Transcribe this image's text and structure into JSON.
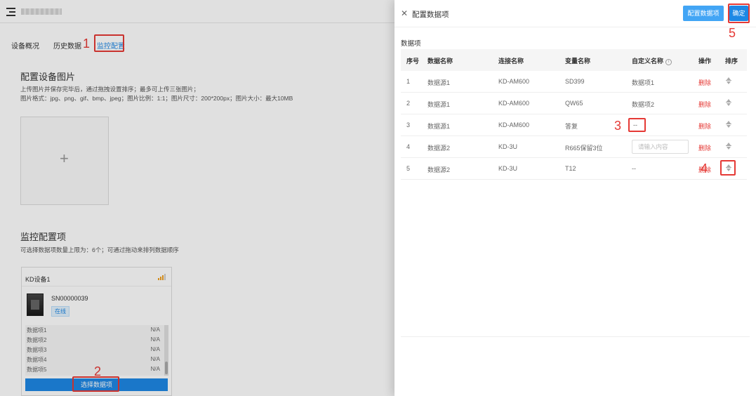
{
  "tabs": [
    {
      "label": "设备概况"
    },
    {
      "label": "历史数据"
    },
    {
      "label": "监控配置"
    }
  ],
  "image_section": {
    "title": "配置设备图片",
    "hint1": "上传图片并保存完毕后，通过拖拽设置排序；最多可上传三张图片；",
    "hint2": "图片格式：jpg、png、gif、bmp、jpeg；图片比例：1:1；图片尺寸：200*200px；图片大小：最大10MB"
  },
  "monitor_section": {
    "title": "监控配置项",
    "hint": "可选择数据项数量上限为：6个；可通过拖动来排列数据顺序"
  },
  "device_card": {
    "name": "KD设备1",
    "sn": "SN00000039",
    "status": "在线",
    "rows": [
      {
        "name": "数据项1",
        "value": "N/A"
      },
      {
        "name": "数据项2",
        "value": "N/A"
      },
      {
        "name": "数据项3",
        "value": "N/A"
      },
      {
        "name": "数据项4",
        "value": "N/A"
      },
      {
        "name": "数据项5",
        "value": "N/A"
      }
    ],
    "select_button": "选择数据项"
  },
  "drawer": {
    "title": "配置数据项",
    "config_button": "配置数据项",
    "ok_button": "确定",
    "section_label": "数据项",
    "columns": [
      "序号",
      "数据名称",
      "连接名称",
      "变量名称",
      "自定义名称",
      "操作",
      "排序"
    ],
    "input_placeholder": "请输入内容",
    "rows": [
      {
        "no": "1",
        "data": "数据源1",
        "conn": "KD-AM600",
        "var": "SD399",
        "alias": "数据项1",
        "op": "删除"
      },
      {
        "no": "2",
        "data": "数据源1",
        "conn": "KD-AM600",
        "var": "QW65",
        "alias": "数据项2",
        "op": "删除"
      },
      {
        "no": "3",
        "data": "数据源1",
        "conn": "KD-AM600",
        "var": "答复",
        "alias": "--",
        "op": "删除"
      },
      {
        "no": "4",
        "data": "数据源2",
        "conn": "KD-3U",
        "var": "R665保留3位",
        "alias": "",
        "op": "删除"
      },
      {
        "no": "5",
        "data": "数据源2",
        "conn": "KD-3U",
        "var": "T12",
        "alias": "--",
        "op": "删除"
      }
    ]
  },
  "annotations": [
    "1",
    "2",
    "3",
    "4",
    "5"
  ],
  "colors": {
    "primary": "#1e88e5",
    "danger": "#e53935",
    "annotation": "#e53935"
  }
}
